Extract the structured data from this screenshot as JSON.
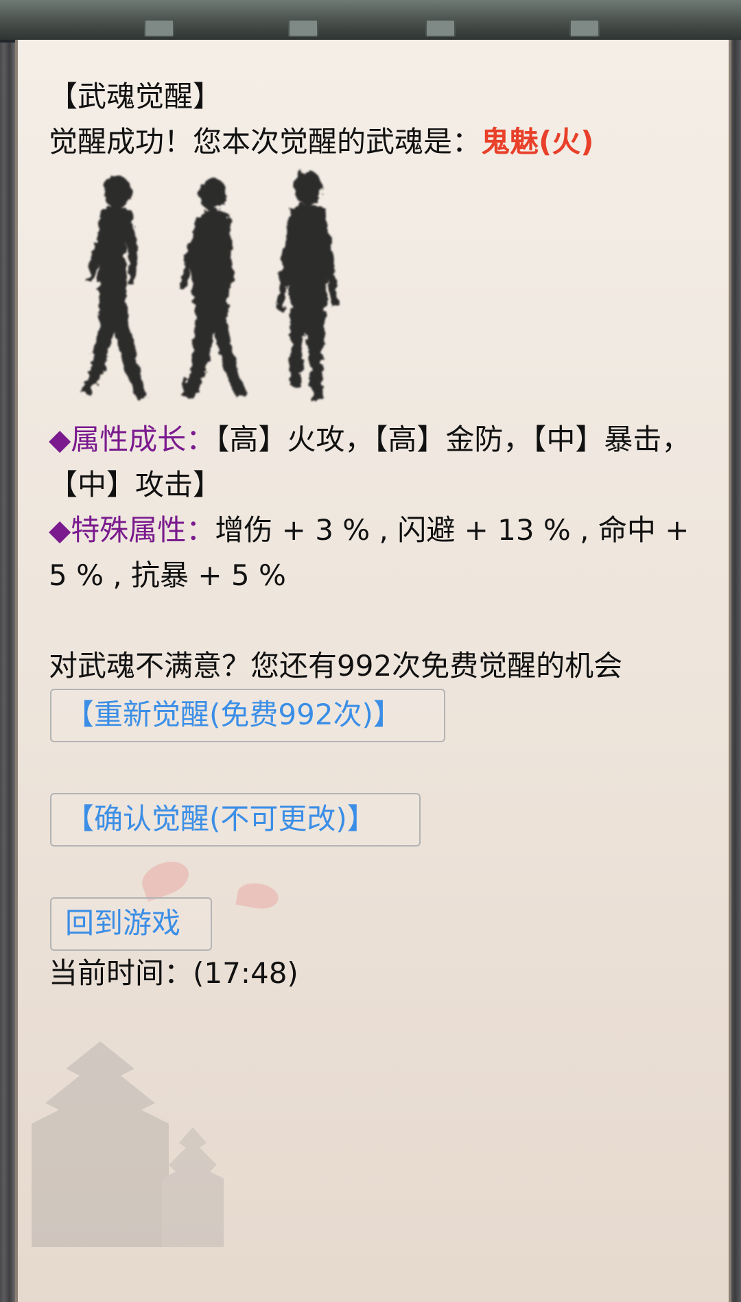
{
  "header": {
    "title": "【武魂觉醒】"
  },
  "result": {
    "prefix": "觉醒成功！您本次觉醒的武魂是：",
    "name": "鬼魅(火)",
    "name_color": "#e8402a"
  },
  "image": {
    "icon": "shadow-silhouettes-icon"
  },
  "growth": {
    "label": "◆属性成长：",
    "text": "【高】火攻，【高】金防，【中】暴击，【中】攻击】"
  },
  "special": {
    "label": "◆特殊属性：",
    "text": "增伤 + 3 % , 闪避 + 13 % , 命中 + 5 % , 抗暴 + 5 %"
  },
  "prompt": "对武魂不满意？您还有992次免费觉醒的机会",
  "buttons": {
    "reawaken": "【重新觉醒(免费992次)】",
    "confirm": "【确认觉醒(不可更改)】",
    "back": "回到游戏"
  },
  "time": {
    "text": "当前时间：(17:48)"
  },
  "colors": {
    "accent_label": "#7a1a8e",
    "link": "#3b8ee6",
    "highlight": "#e8402a"
  }
}
